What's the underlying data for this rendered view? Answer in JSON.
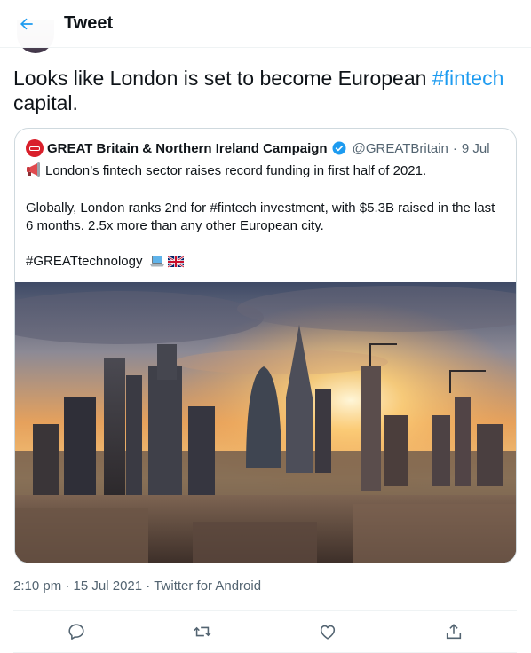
{
  "header": {
    "title": "Tweet"
  },
  "tweet": {
    "text_before": "Looks like London is set to become European ",
    "hashtag": "#fintech",
    "text_after": " capital.",
    "time": "2:10 pm",
    "separator": " · ",
    "date": "15 Jul 2021",
    "source": "Twitter for Android"
  },
  "quote": {
    "name": "GREAT Britain & Northern Ireland Campaign",
    "handle": "@GREATBritain",
    "dot": "·",
    "date": "9 Jul",
    "line1": "London’s fintech sector raises record funding in first half of 2021.",
    "line2": "Globally, London ranks 2nd for #fintech investment, with $5.3B raised in the last 6 months. 2.5x more than any other European city.",
    "line3": "#GREATtechnology"
  },
  "colors": {
    "accent": "#1d9bf0",
    "text": "#0f1419",
    "secondary": "#536471",
    "brand_red": "#d91f2b"
  },
  "icons": [
    "back-arrow-icon",
    "verified-badge-icon",
    "megaphone-icon",
    "laptop-icon",
    "uk-flag-icon",
    "reply-icon",
    "retweet-icon",
    "like-icon",
    "share-icon"
  ]
}
